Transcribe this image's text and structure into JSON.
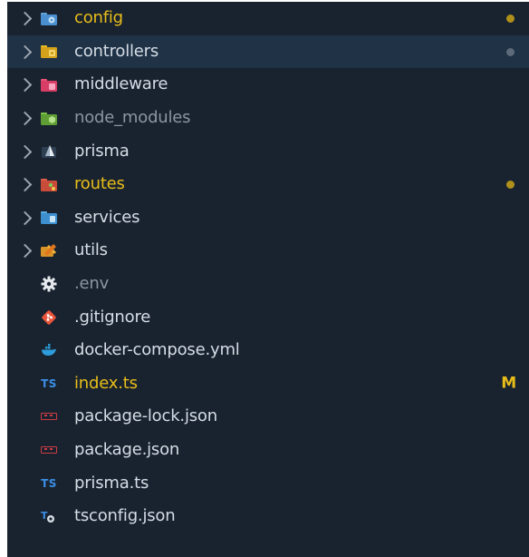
{
  "explorer": {
    "items": [
      {
        "label": "config",
        "type": "folder",
        "icon": "folder-config-icon",
        "status": "modified"
      },
      {
        "label": "controllers",
        "type": "folder",
        "icon": "folder-controllers-icon",
        "status": "dot-selected"
      },
      {
        "label": "middleware",
        "type": "folder",
        "icon": "folder-middleware-icon",
        "status": ""
      },
      {
        "label": "node_modules",
        "type": "folder",
        "icon": "folder-node-icon",
        "status": "ignored"
      },
      {
        "label": "prisma",
        "type": "folder",
        "icon": "prisma-icon",
        "status": ""
      },
      {
        "label": "routes",
        "type": "folder",
        "icon": "folder-routes-icon",
        "status": "modified"
      },
      {
        "label": "services",
        "type": "folder",
        "icon": "folder-services-icon",
        "status": ""
      },
      {
        "label": "utils",
        "type": "folder",
        "icon": "folder-utils-icon",
        "status": ""
      },
      {
        "label": ".env",
        "type": "file",
        "icon": "gear-icon",
        "status": ""
      },
      {
        "label": ".gitignore",
        "type": "file",
        "icon": "git-icon",
        "status": ""
      },
      {
        "label": "docker-compose.yml",
        "type": "file",
        "icon": "docker-icon",
        "status": ""
      },
      {
        "label": "index.ts",
        "type": "file",
        "icon": "typescript-icon",
        "status": "modified",
        "badge": "M"
      },
      {
        "label": "package-lock.json",
        "type": "file",
        "icon": "npm-icon",
        "status": ""
      },
      {
        "label": "package.json",
        "type": "file",
        "icon": "npm-icon",
        "status": ""
      },
      {
        "label": "prisma.ts",
        "type": "file",
        "icon": "typescript-icon",
        "status": ""
      },
      {
        "label": "tsconfig.json",
        "type": "file",
        "icon": "tsconfig-icon",
        "status": ""
      }
    ]
  },
  "icon_glyphs": {
    "typescript": "TS"
  },
  "colors": {
    "background": "#19232f",
    "selected_row": "#1f3246",
    "modified": "#e9bd19",
    "text": "#d5dde6",
    "dimmed": "#8a96a2",
    "dot_muted": "#6a7a8a"
  }
}
